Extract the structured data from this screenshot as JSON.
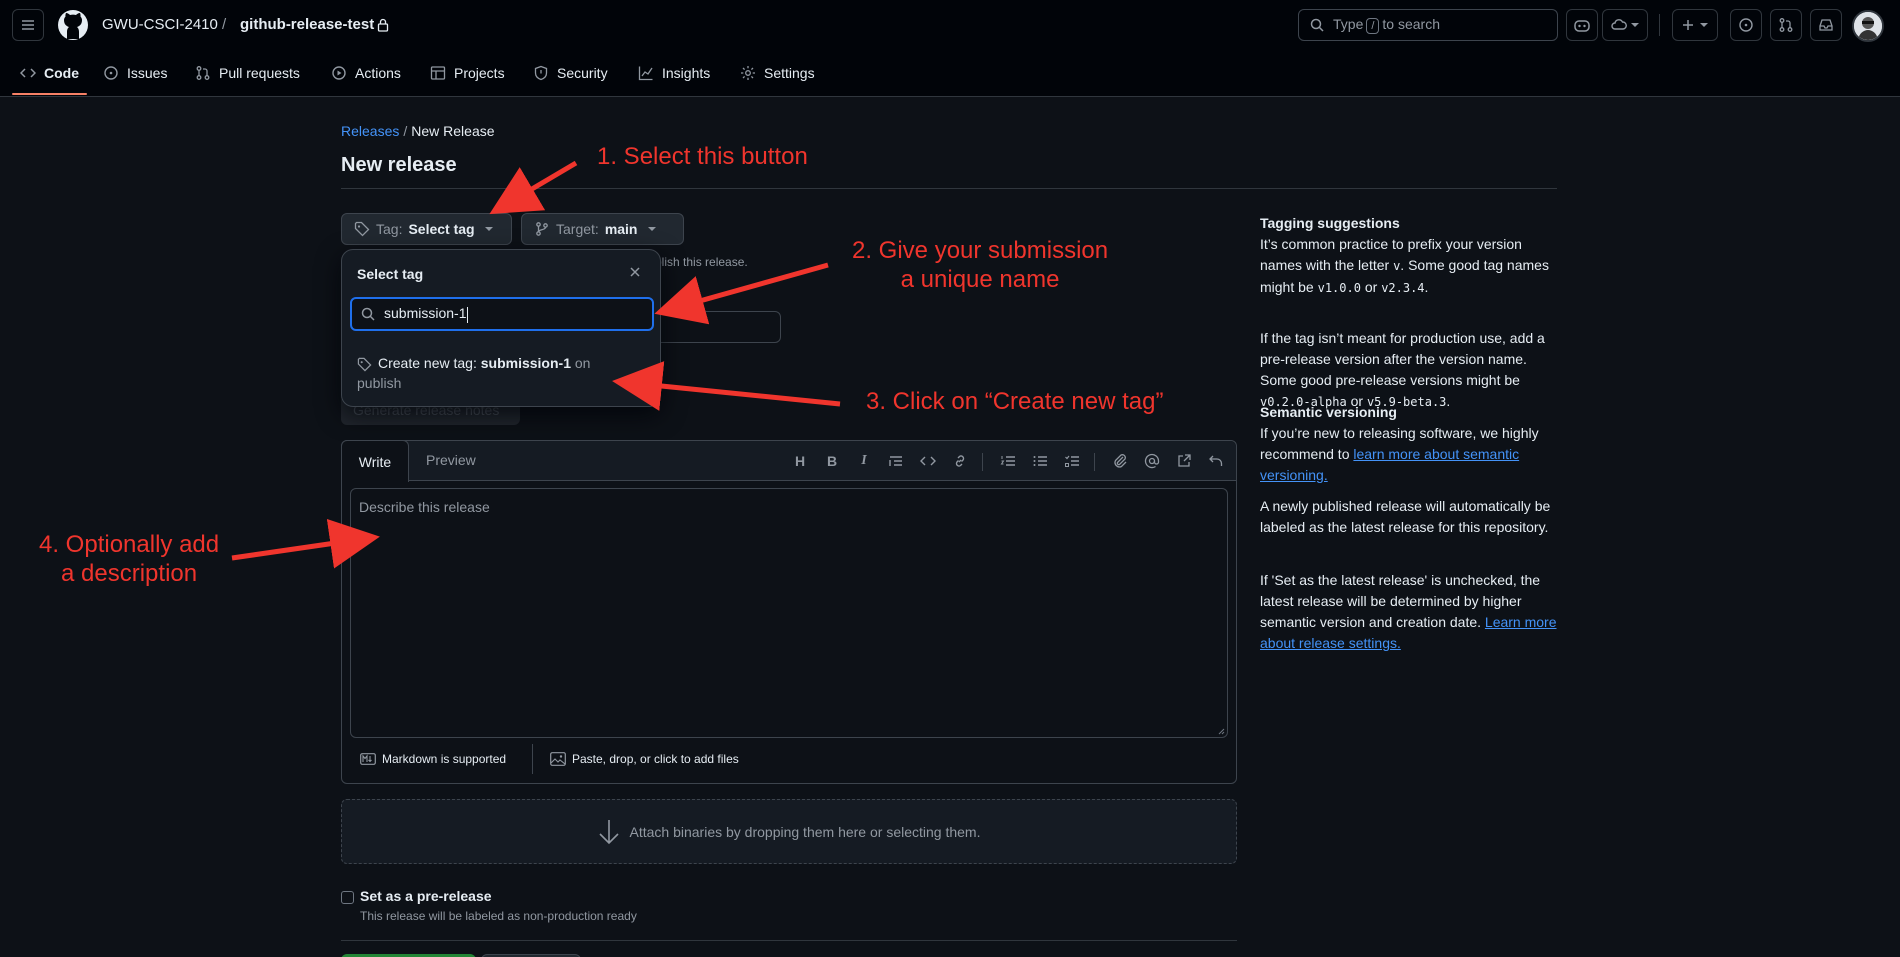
{
  "header": {
    "owner": "GWU-CSCI-2410",
    "slash": "/",
    "repo": "github-release-test",
    "search_prefix": "Type",
    "search_key": "/",
    "search_suffix": "to search"
  },
  "nav": {
    "tabs": [
      {
        "label": "Code",
        "icon": "code-icon"
      },
      {
        "label": "Issues",
        "icon": "issue-icon"
      },
      {
        "label": "Pull requests",
        "icon": "pull-request-icon"
      },
      {
        "label": "Actions",
        "icon": "play-icon"
      },
      {
        "label": "Projects",
        "icon": "table-icon"
      },
      {
        "label": "Security",
        "icon": "shield-icon"
      },
      {
        "label": "Insights",
        "icon": "graph-icon"
      },
      {
        "label": "Settings",
        "icon": "gear-icon"
      }
    ]
  },
  "breadcrumb": {
    "releases": "Releases",
    "sep": "/",
    "current": "New Release"
  },
  "page": {
    "title": "New release"
  },
  "tag_button": {
    "prefix": "Tag:",
    "value": "Select tag"
  },
  "target_button": {
    "prefix": "Target:",
    "value": "main"
  },
  "hint_fragment": "blish this release.",
  "generate_notes": "Generate release notes",
  "dropdown": {
    "title": "Select tag",
    "input_value": "submission-1",
    "create_prefix": "Create new tag:",
    "create_name": "submission-1",
    "create_suffix": "on",
    "create_suffix2": "publish"
  },
  "editor": {
    "tab_write": "Write",
    "tab_preview": "Preview",
    "placeholder": "Describe this release",
    "markdown_note": "Markdown is supported",
    "attach_note": "Paste, drop, or click to add files"
  },
  "binaries": "Attach binaries by dropping them here or selecting them.",
  "prerelease": {
    "label": "Set as a pre-release",
    "description": "This release will be labeled as non-production ready"
  },
  "sidebar": {
    "tagging_title": "Tagging suggestions",
    "tagging_p1a": "It’s common practice to prefix your version names with the letter",
    "tagging_p1_code1": "v",
    "tagging_p1b": ". Some good tag names might be",
    "tagging_p1_code2": "v1.0.0",
    "tagging_p1c": "or",
    "tagging_p1_code3": "v2.3.4",
    "tagging_p1d": ".",
    "tagging_p2a": "If the tag isn’t meant for production use, add a pre-release version after the version name. Some good pre-release versions might be",
    "tagging_p2_code1": "v0.2.0-alpha",
    "tagging_p2b": "or",
    "tagging_p2_code2": "v5.9-beta.3",
    "tagging_p2c": ".",
    "semver_title": "Semantic versioning",
    "semver_p1a": "If you’re new to releasing software, we highly recommend to",
    "semver_link": "learn more about semantic versioning.",
    "latest_p": "A newly published release will automatically be labeled as the latest release for this repository.",
    "unchecked_p": "If 'Set as the latest release' is unchecked, the latest release will be determined by higher semantic version and creation date.",
    "settings_link": "Learn more about release settings."
  },
  "annotations": {
    "step1": "1. Select this button",
    "step2_l1": "2. Give your submission",
    "step2_l2": "a unique name",
    "step3": "3. Click on “Create new tag”",
    "step4_l1": "4. Optionally add",
    "step4_l2": "a description"
  },
  "colors": {
    "background": "#0d1117",
    "header": "#010409",
    "accent_link": "#4493f8",
    "focus_border": "#1f6feb",
    "annotation": "#f0352d",
    "active_tab_underline": "#f78166"
  }
}
